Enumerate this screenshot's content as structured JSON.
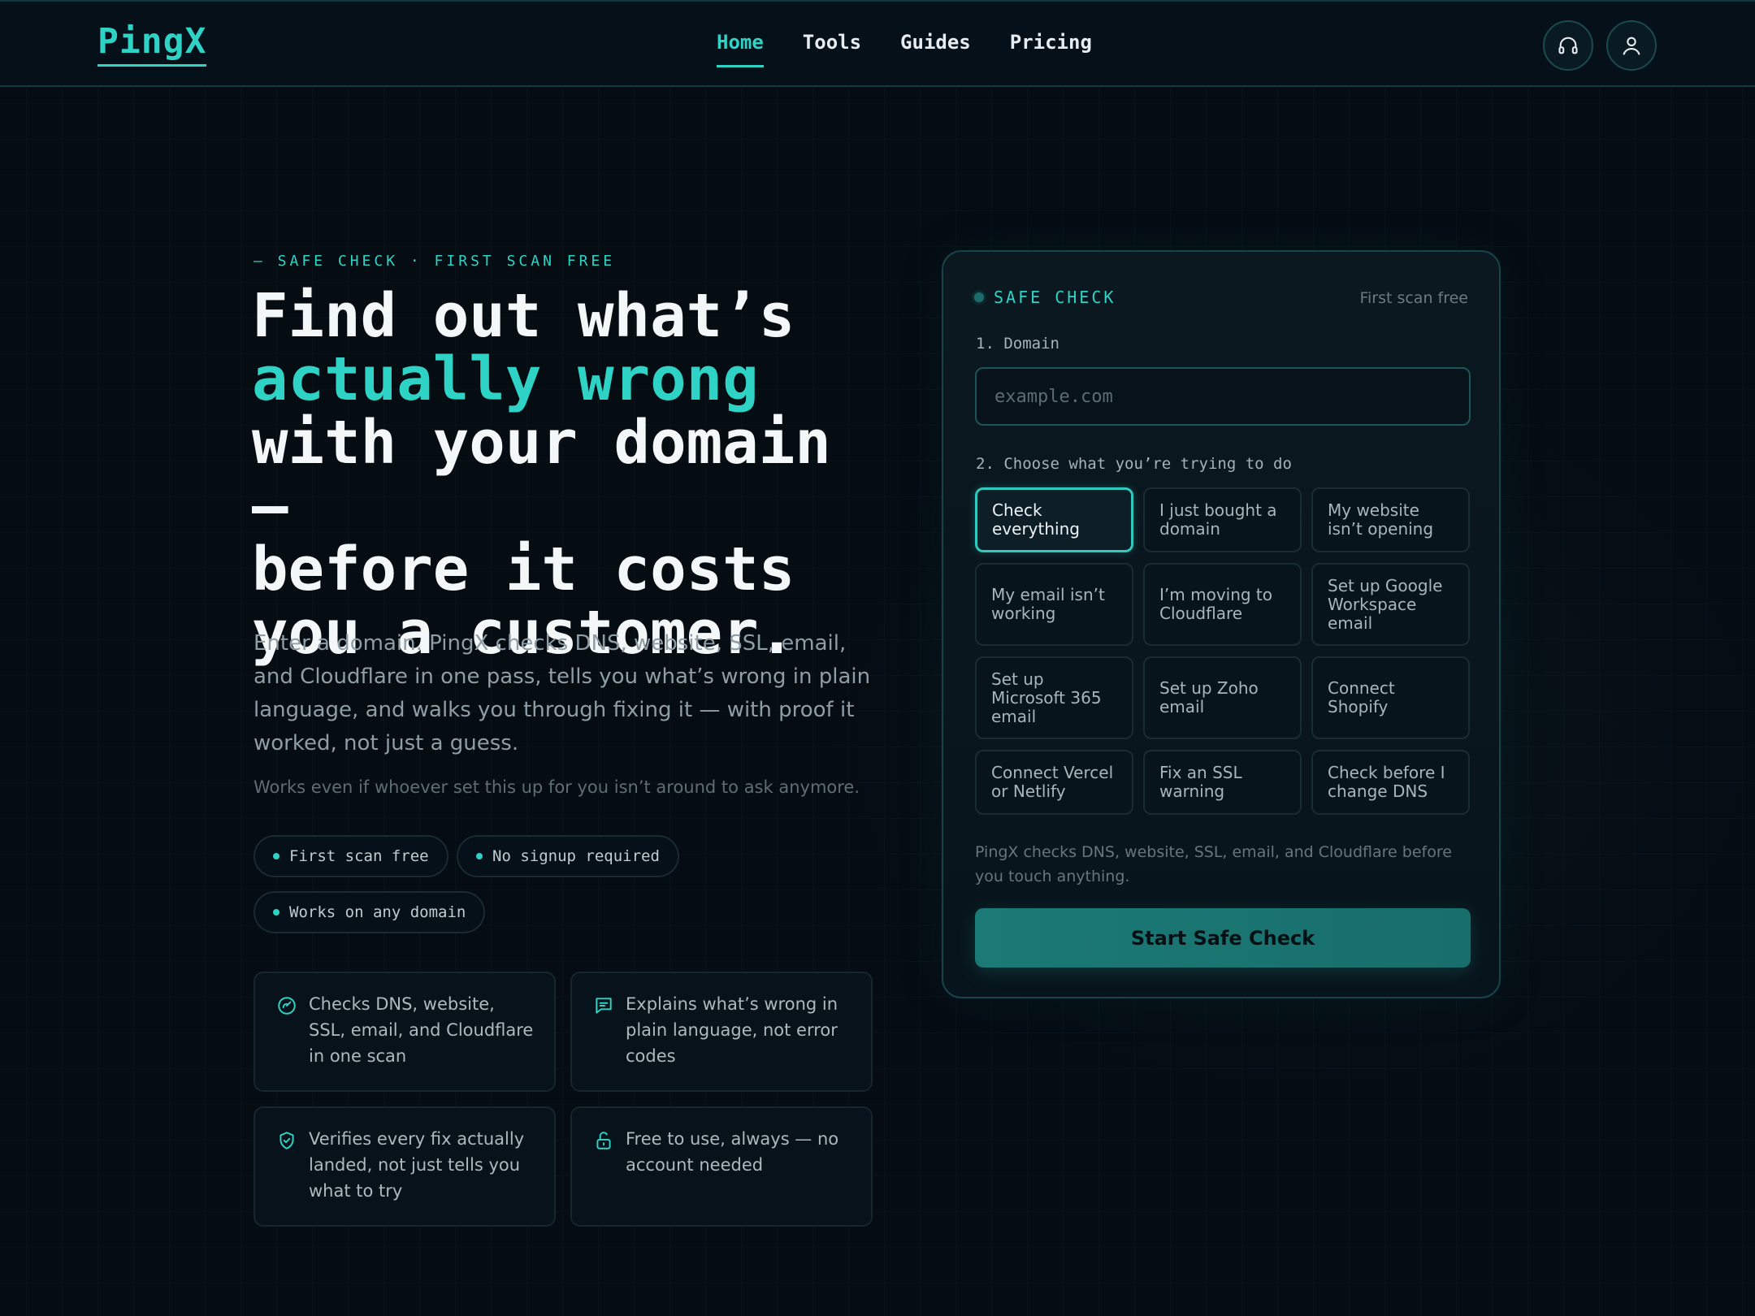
{
  "header": {
    "logo": "PingX",
    "nav": [
      {
        "label": "Home",
        "active": true
      },
      {
        "label": "Tools",
        "active": false
      },
      {
        "label": "Guides",
        "active": false
      },
      {
        "label": "Pricing",
        "active": false
      }
    ],
    "icons": [
      "headset-icon",
      "user-icon"
    ]
  },
  "hero": {
    "eyebrow": "— SAFE CHECK · FIRST SCAN FREE",
    "headline_1": "Find out what’s",
    "headline_accent": "actually wrong",
    "headline_2": "with your domain —",
    "headline_3": "before it costs",
    "headline_4": "you a customer.",
    "lede": "Enter a domain. PingX checks DNS, website, SSL, email, and Cloudflare in one pass, tells you what’s wrong in plain language, and walks you through fixing it — with proof it worked, not just a guess.",
    "sublede": "Works even if whoever set this up for you isn’t around to ask anymore.",
    "pills": [
      "First scan free",
      "No signup required",
      "Works on any domain"
    ]
  },
  "features": [
    {
      "icon": "gauge-icon",
      "text": "Checks DNS, website, SSL, email, and Cloudflare in one scan"
    },
    {
      "icon": "message-icon",
      "text": "Explains what’s wrong in plain language, not error codes"
    },
    {
      "icon": "shield-check-icon",
      "text": "Verifies every fix actually landed, not just tells you what to try"
    },
    {
      "icon": "lock-open-icon",
      "text": "Free to use, always — no account needed"
    }
  ],
  "card": {
    "title": "SAFE CHECK",
    "note": "First scan free",
    "step1_label": "1. Domain",
    "domain_placeholder": "example.com",
    "domain_value": "",
    "step2_label": "2. Choose what you’re trying to do",
    "options": [
      "Check everything",
      "I just bought a domain",
      "My website isn’t opening",
      "My email isn’t working",
      "I’m moving to Cloudflare",
      "Set up Google Workspace email",
      "Set up Microsoft 365 email",
      "Set up Zoho email",
      "Connect Shopify",
      "Connect Vercel or Netlify",
      "Fix an SSL warning",
      "Check before I change DNS"
    ],
    "selected_option": "Check everything",
    "helper": "PingX checks DNS, website, SSL, email, and Cloudflare before you touch anything.",
    "cta": "Start Safe Check"
  },
  "colors": {
    "accent": "#2fd3c6",
    "background": "#050c12",
    "cta": "#1b7a76"
  }
}
